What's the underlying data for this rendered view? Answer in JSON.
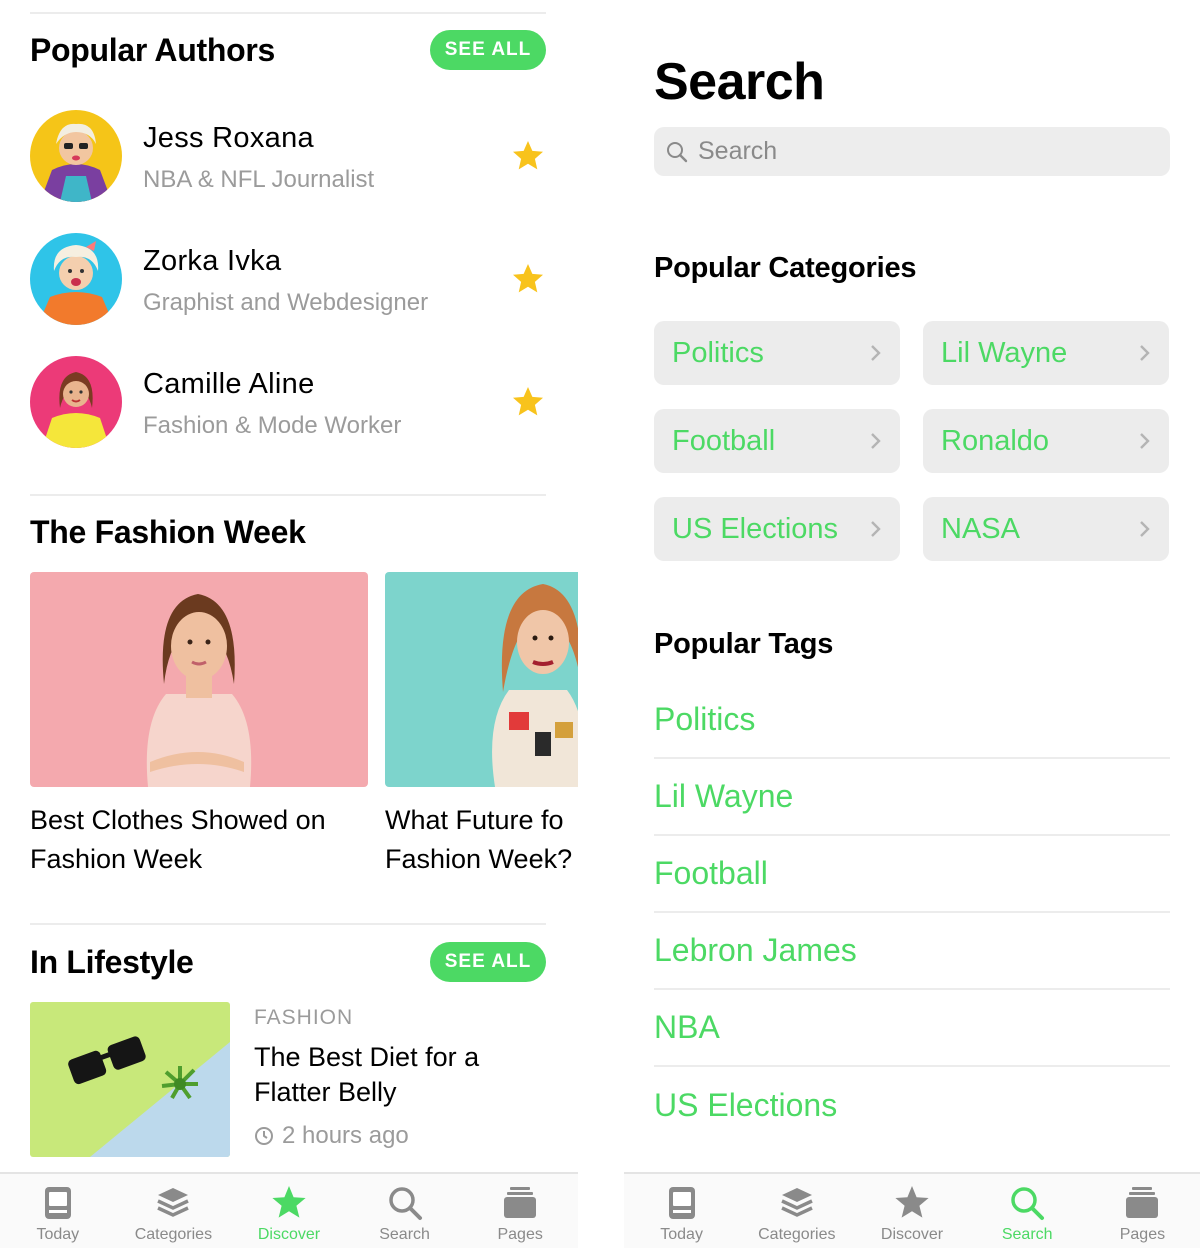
{
  "colors": {
    "accent": "#4cd964",
    "muted": "#9b9b9b",
    "star": "#f8c31c",
    "panel": "#ececec"
  },
  "discover": {
    "popular_authors": {
      "title": "Popular Authors",
      "see_all": "SEE ALL",
      "authors": [
        {
          "name": "Jess Roxana",
          "role": "NBA & NFL Journalist",
          "starred": true
        },
        {
          "name": "Zorka Ivka",
          "role": "Graphist and Webdesigner",
          "starred": true
        },
        {
          "name": "Camille Aline",
          "role": "Fashion & Mode Worker",
          "starred": true
        }
      ]
    },
    "fashion_week": {
      "title": "The Fashion Week",
      "cards": [
        {
          "title_line1": "Best Clothes Showed on",
          "title_line2": "Fashion Week"
        },
        {
          "title_line1": "What Future fo",
          "title_line2": "Fashion Week?"
        }
      ]
    },
    "lifestyle": {
      "title": "In Lifestyle",
      "see_all": "SEE ALL",
      "article": {
        "category": "FASHION",
        "title": "The Best Diet for a Flatter Belly",
        "time": "2 hours ago"
      }
    }
  },
  "search_page": {
    "title": "Search",
    "search_placeholder": "Search",
    "popular_categories": {
      "title": "Popular Categories",
      "items": [
        "Politics",
        "Lil Wayne",
        "Football",
        "Ronaldo",
        "US Elections",
        "NASA"
      ]
    },
    "popular_tags": {
      "title": "Popular Tags",
      "items": [
        "Politics",
        "Lil Wayne",
        "Football",
        "Lebron James",
        "NBA",
        "US Elections"
      ]
    }
  },
  "tabbar_left": {
    "active": "Discover",
    "tabs": [
      {
        "label": "Today",
        "icon": "today-icon"
      },
      {
        "label": "Categories",
        "icon": "layers-icon"
      },
      {
        "label": "Discover",
        "icon": "star-icon"
      },
      {
        "label": "Search",
        "icon": "search-icon"
      },
      {
        "label": "Pages",
        "icon": "pages-icon"
      }
    ]
  },
  "tabbar_right": {
    "active": "Search",
    "tabs": [
      {
        "label": "Today",
        "icon": "today-icon"
      },
      {
        "label": "Categories",
        "icon": "layers-icon"
      },
      {
        "label": "Discover",
        "icon": "star-icon"
      },
      {
        "label": "Search",
        "icon": "search-icon"
      },
      {
        "label": "Pages",
        "icon": "pages-icon"
      }
    ]
  }
}
